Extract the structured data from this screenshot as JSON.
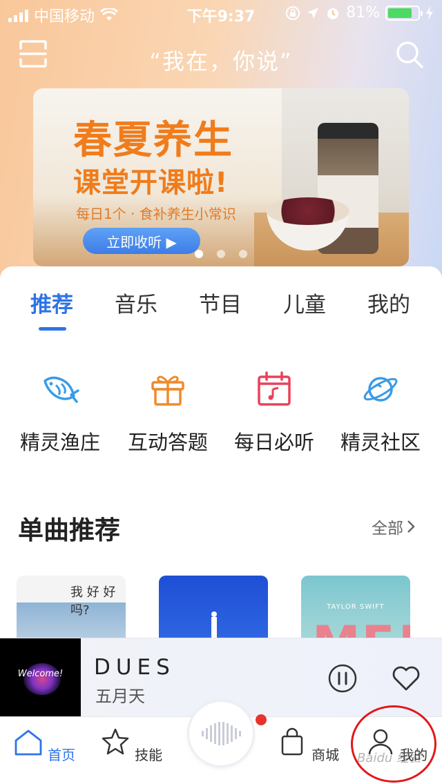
{
  "status_bar": {
    "carrier": "中国移动",
    "time": "下午9:37",
    "battery_percent": "81%",
    "battery_level": 0.81,
    "battery_color": "#4cd964"
  },
  "header": {
    "title": "“我在，你说”",
    "left_icon": "scan-icon",
    "right_icon": "search-icon"
  },
  "banner": {
    "title_line1": "春夏养生",
    "title_line2": "课堂开课啦!",
    "subtitle": "每日1个 · 食补养生小常识",
    "button_label": "立即收听 ▶",
    "slide_count": 3,
    "active_slide": 1
  },
  "tabs": [
    {
      "label": "推荐",
      "active": true
    },
    {
      "label": "音乐",
      "active": false
    },
    {
      "label": "节目",
      "active": false
    },
    {
      "label": "儿童",
      "active": false
    },
    {
      "label": "我的",
      "active": false
    }
  ],
  "features": [
    {
      "label": "精灵渔庄",
      "icon": "fish-icon",
      "color": "#3a9be6"
    },
    {
      "label": "互动答题",
      "icon": "gift-icon",
      "color": "#f08a2a"
    },
    {
      "label": "每日必听",
      "icon": "calendar-music-icon",
      "color": "#e8425a"
    },
    {
      "label": "精灵社区",
      "icon": "planet-icon",
      "color": "#3a9be6"
    }
  ],
  "section": {
    "title": "单曲推荐",
    "see_all": "全部"
  },
  "albums": [
    {
      "text": "我 好 好 吗?"
    },
    {
      "text": ""
    },
    {
      "text": "TAYLOR SWIFT",
      "big_text": "ME!"
    }
  ],
  "now_playing": {
    "title": "DUES",
    "artist": "五月天",
    "cover_text": "Welcome!"
  },
  "tabbar": [
    {
      "label": "首页",
      "icon": "home-icon",
      "active": true
    },
    {
      "label": "技能",
      "icon": "star-icon",
      "active": false
    },
    {
      "label": "商城",
      "icon": "shopping-bag-icon",
      "active": false
    },
    {
      "label": "我的",
      "icon": "user-icon",
      "active": false
    }
  ],
  "accent_color": "#2e73e6",
  "watermark": "Baidu 经验"
}
